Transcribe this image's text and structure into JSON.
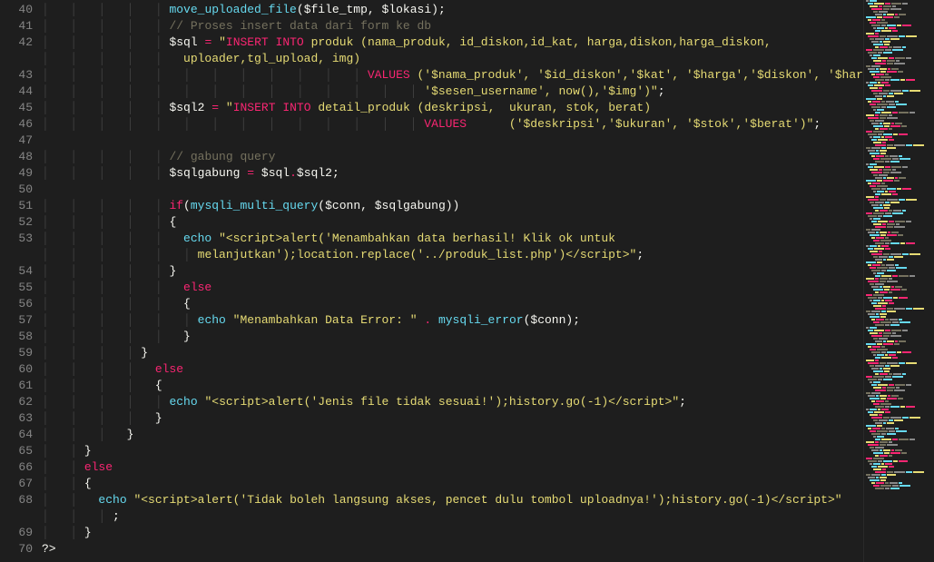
{
  "lines": [
    {
      "num": 40,
      "html": "<span class='indent-guide'>│   │   │   │   │ </span><span class='fn'>move_uploaded_file</span><span class='paren'>(</span><span class='var'>$file_tmp</span><span class='punct'>, </span><span class='var'>$lokasi</span><span class='paren'>)</span><span class='punct'>;</span>"
    },
    {
      "num": 41,
      "html": "<span class='indent-guide'>│   │   │   │   │ </span><span class='comment'>// Proses insert data dari form ke db</span>"
    },
    {
      "num": 42,
      "html": "<span class='indent-guide'>│   │   │   │   │ </span><span class='var'>$sql</span> <span class='op'>=</span> <span class='str'>\"</span><span class='kw-sql'>INSERT</span> <span class='kw-sql'>INTO</span> <span class='str'>produk (nama_produk, id_diskon,id_kat, harga,diskon,harga_diskon,</span>"
    },
    {
      "num": "",
      "html": "<span class='indent-guide'>│   │   │   │   │   </span><span class='str'>uploader,tgl_upload, img)</span>"
    },
    {
      "num": 43,
      "html": "<span class='indent-guide'>│   │   │   │   │   │   │   │   │   │   │   │ </span><span class='kw-sql'>VALUES</span> <span class='str'>('$nama_produk', '$id_diskon','$kat', '$harga','$diskon', '$harga_diskon',</span>"
    },
    {
      "num": 44,
      "html": "<span class='indent-guide'>│   │   │   │   │   │   │   │   │   │   │   │   │   │ </span><span class='str'>'$sesen_username', now(),'$img')\"</span><span class='punct'>;</span>"
    },
    {
      "num": 45,
      "html": "<span class='indent-guide'>│   │   │   │   │ </span><span class='var'>$sql2</span> <span class='op'>=</span> <span class='str'>\"</span><span class='kw-sql'>INSERT</span> <span class='kw-sql'>INTO</span> <span class='str'>detail_produk (deskripsi,  ukuran, stok, berat)</span>"
    },
    {
      "num": 46,
      "html": "<span class='indent-guide'>│   │   │   │   │   │   │   │   │   │   │   │   │   │ </span><span class='kw-sql'>VALUES</span>      <span class='str'>('$deskripsi','$ukuran', '$stok','$berat')\"</span><span class='punct'>;</span>"
    },
    {
      "num": 47,
      "html": ""
    },
    {
      "num": 48,
      "html": "<span class='indent-guide'>│   │   │   │   │ </span><span class='comment'>// gabung query</span>"
    },
    {
      "num": 49,
      "html": "<span class='indent-guide'>│   │   │   │   │ </span><span class='var'>$sqlgabung</span> <span class='op'>=</span> <span class='var'>$sql</span><span class='op'>.</span><span class='var'>$sql2</span><span class='punct'>;</span>"
    },
    {
      "num": 50,
      "html": ""
    },
    {
      "num": 51,
      "html": "<span class='indent-guide'>│   │   │   │   │ </span><span class='kw'>if</span><span class='paren'>(</span><span class='fn'>mysqli_multi_query</span><span class='paren'>(</span><span class='var'>$conn</span><span class='punct'>, </span><span class='var'>$sqlgabung</span><span class='paren'>))</span>"
    },
    {
      "num": 52,
      "html": "<span class='indent-guide'>│   │   │   │   │ </span><span class='punct'>{</span>"
    },
    {
      "num": 53,
      "html": "<span class='indent-guide'>│   │   │   │   │   </span><span class='echo'>echo</span> <span class='str'>\"&lt;script&gt;alert('Menambahkan data berhasil! Klik ok untuk </span>"
    },
    {
      "num": "",
      "html": "<span class='indent-guide'>│   │   │   │   │   │ </span><span class='str'>melanjutkan');location.replace('../produk_list.php')&lt;/script&gt;\"</span><span class='punct'>;</span>"
    },
    {
      "num": 54,
      "html": "<span class='indent-guide'>│   │   │   │   │ </span><span class='punct'>}</span>"
    },
    {
      "num": 55,
      "html": "<span class='indent-guide'>│   │   │   │   │   </span><span class='kw'>else</span>"
    },
    {
      "num": 56,
      "html": "<span class='indent-guide'>│   │   │   │   │   </span><span class='punct'>{</span>"
    },
    {
      "num": 57,
      "html": "<span class='indent-guide'>│   │   │   │   │   │ </span><span class='echo'>echo</span> <span class='str'>\"Menambahkan Data Error: \"</span> <span class='op'>.</span> <span class='fn'>mysqli_error</span><span class='paren'>(</span><span class='var'>$conn</span><span class='paren'>)</span><span class='punct'>;</span>"
    },
    {
      "num": 58,
      "html": "<span class='indent-guide'>│   │   │   │   │   </span><span class='punct'>}</span>"
    },
    {
      "num": 59,
      "html": "<span class='indent-guide'>│   │   │   │ </span><span class='punct'>}</span>"
    },
    {
      "num": 60,
      "html": "<span class='indent-guide'>│   │   │   │   </span><span class='kw'>else</span>"
    },
    {
      "num": 61,
      "html": "<span class='indent-guide'>│   │   │   │   </span><span class='punct'>{</span>"
    },
    {
      "num": 62,
      "html": "<span class='indent-guide'>│   │   │   │   │ </span><span class='echo'>echo</span> <span class='str'>\"&lt;script&gt;alert('Jenis file tidak sesuai!');history.go(-1)&lt;/script&gt;\"</span><span class='punct'>;</span>"
    },
    {
      "num": 63,
      "html": "<span class='indent-guide'>│   │   │   │   </span><span class='punct'>}</span>"
    },
    {
      "num": 64,
      "html": "<span class='indent-guide'>│   │   │   </span><span class='punct'>}</span>"
    },
    {
      "num": 65,
      "html": "<span class='indent-guide'>│   │ </span><span class='punct'>}</span>"
    },
    {
      "num": 66,
      "html": "<span class='indent-guide'>│   │ </span><span class='kw'>else</span>"
    },
    {
      "num": 67,
      "html": "<span class='indent-guide'>│   │ </span><span class='punct'>{</span>"
    },
    {
      "num": 68,
      "html": "<span class='indent-guide'>│   │   </span><span class='echo'>echo</span> <span class='str'>\"&lt;script&gt;alert('Tidak boleh langsung akses, pencet dulu tombol uploadnya!');history.go(-1)&lt;/script&gt;\"</span>"
    },
    {
      "num": "",
      "html": "<span class='indent-guide'>│   │   │ </span><span class='punct'>;</span>"
    },
    {
      "num": 69,
      "html": "<span class='indent-guide'>│   │ </span><span class='punct'>}</span>"
    },
    {
      "num": 70,
      "html": "<span class='punct'>?&gt;</span>"
    }
  ]
}
